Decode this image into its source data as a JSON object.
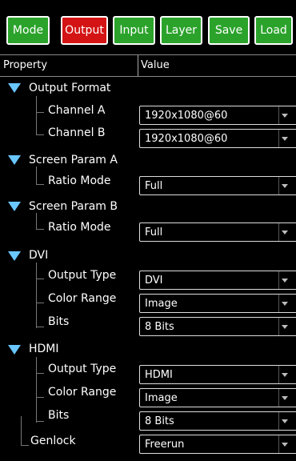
{
  "toolbar": {
    "buttons": [
      {
        "label": "Mode"
      },
      {
        "label": "Output"
      },
      {
        "label": "Input"
      },
      {
        "label": "Layer"
      },
      {
        "label": "Save"
      },
      {
        "label": "Load"
      }
    ],
    "active": "Output"
  },
  "table": {
    "col_property": "Property",
    "col_value": "Value"
  },
  "groups": {
    "output_format": {
      "title": "Output Format",
      "channel_a": {
        "label": "Channel A",
        "value": "1920x1080@60"
      },
      "channel_b": {
        "label": "Channel B",
        "value": "1920x1080@60"
      }
    },
    "screen_param_a": {
      "title": "Screen Param A",
      "ratio_mode": {
        "label": "Ratio Mode",
        "value": "Full"
      }
    },
    "screen_param_b": {
      "title": "Screen Param B",
      "ratio_mode": {
        "label": "Ratio Mode",
        "value": "Full"
      }
    },
    "dvi": {
      "title": "DVI",
      "output_type": {
        "label": "Output Type",
        "value": "DVI"
      },
      "color_range": {
        "label": "Color Range",
        "value": "Image"
      },
      "bits": {
        "label": "Bits",
        "value": "8 Bits"
      }
    },
    "hdmi": {
      "title": "HDMI",
      "output_type": {
        "label": "Output Type",
        "value": "HDMI"
      },
      "color_range": {
        "label": "Color Range",
        "value": "Image"
      },
      "bits": {
        "label": "Bits",
        "value": "8 Bits"
      }
    },
    "genlock": {
      "label": "Genlock",
      "value": "Freerun"
    }
  }
}
